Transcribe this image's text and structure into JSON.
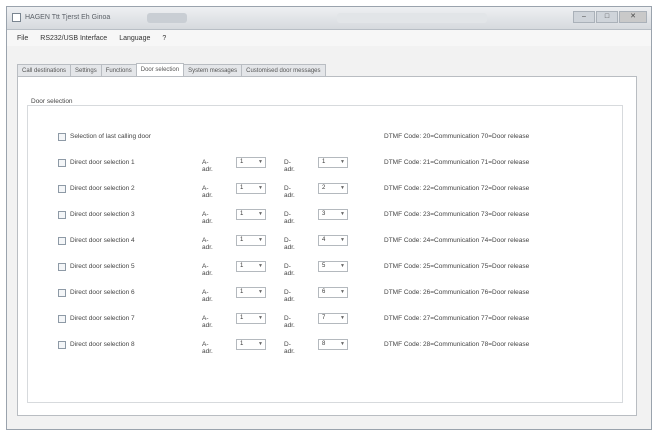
{
  "window": {
    "title": "HAGEN Ttt Tjerst Eh Ginoa"
  },
  "titlebar_controls": {
    "min": "–",
    "max": "□",
    "close": "✕"
  },
  "menu": [
    "File",
    "RS232/USB Interface",
    "Language",
    "?"
  ],
  "tabs": [
    "Call destinations",
    "Settings",
    "Functions",
    "Door selection",
    "System messages",
    "Customised door messages"
  ],
  "group": {
    "title": "Door selection",
    "tenant_label": "Selection of last calling door",
    "rows": [
      {
        "label": "Direct door selection 1",
        "a_label": "A-adr.",
        "a_value": "1",
        "b_label": "D-adr.",
        "b_value": "1",
        "code": "DTMF Code: 21=Communication   71=Door release"
      },
      {
        "label": "Direct door selection 2",
        "a_label": "A-adr.",
        "a_value": "1",
        "b_label": "D-adr.",
        "b_value": "2",
        "code": "DTMF Code: 22=Communication   72=Door release"
      },
      {
        "label": "Direct door selection 3",
        "a_label": "A-adr.",
        "a_value": "1",
        "b_label": "D-adr.",
        "b_value": "3",
        "code": "DTMF Code: 23=Communication   73=Door release"
      },
      {
        "label": "Direct door selection 4",
        "a_label": "A-adr.",
        "a_value": "1",
        "b_label": "D-adr.",
        "b_value": "4",
        "code": "DTMF Code: 24=Communication   74=Door release"
      },
      {
        "label": "Direct door selection 5",
        "a_label": "A-adr.",
        "a_value": "1",
        "b_label": "D-adr.",
        "b_value": "5",
        "code": "DTMF Code: 25=Communication   75=Door release"
      },
      {
        "label": "Direct door selection 6",
        "a_label": "A-adr.",
        "a_value": "1",
        "b_label": "D-adr.",
        "b_value": "6",
        "code": "DTMF Code: 26=Communication   76=Door release"
      },
      {
        "label": "Direct door selection 7",
        "a_label": "A-adr.",
        "a_value": "1",
        "b_label": "D-adr.",
        "b_value": "7",
        "code": "DTMF Code: 27=Communication   77=Door release"
      },
      {
        "label": "Direct door selection 8",
        "a_label": "A-adr.",
        "a_value": "1",
        "b_label": "D-adr.",
        "b_value": "8",
        "code": "DTMF Code: 28=Communication   78=Door release"
      }
    ],
    "tenant_code": "DTMF Code: 20=Communication   70=Door release"
  },
  "active_tab_index": 3
}
